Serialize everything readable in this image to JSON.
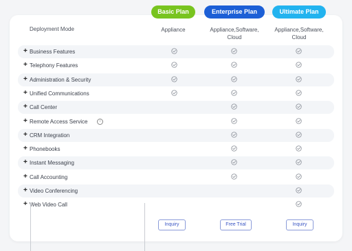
{
  "plans": [
    {
      "name": "Basic Plan",
      "color": "#78c41f"
    },
    {
      "name": "Enterprise Plan",
      "color": "#1c5fd6"
    },
    {
      "name": "Ultimate Plan",
      "color": "#22b3ef"
    }
  ],
  "deployment": {
    "label": "Deployment Mode",
    "values": [
      "Appliance",
      "Appliance,Software,\nCloud",
      "Appliance,Software,\nCloud"
    ]
  },
  "features": [
    {
      "label": "Business Features",
      "checks": [
        true,
        true,
        true
      ]
    },
    {
      "label": "Telephony Features",
      "checks": [
        true,
        true,
        true
      ]
    },
    {
      "label": "Administration & Security",
      "checks": [
        true,
        true,
        true
      ]
    },
    {
      "label": "Unified Communications",
      "checks": [
        true,
        true,
        true
      ]
    },
    {
      "label": "Call Center",
      "checks": [
        false,
        true,
        true
      ]
    },
    {
      "label": "Remote Access Service",
      "checks": [
        false,
        true,
        true
      ],
      "info": true
    },
    {
      "label": "CRM Integration",
      "checks": [
        false,
        true,
        true
      ]
    },
    {
      "label": "Phonebooks",
      "checks": [
        false,
        true,
        true
      ]
    },
    {
      "label": "Instant Messaging",
      "checks": [
        false,
        true,
        true
      ]
    },
    {
      "label": "Call Accounting",
      "checks": [
        false,
        true,
        true
      ]
    },
    {
      "label": "Video Conferencing",
      "checks": [
        false,
        false,
        true
      ]
    },
    {
      "label": "Web Video Call",
      "checks": [
        false,
        false,
        true
      ]
    }
  ],
  "buttons": [
    "Inquiry",
    "Free Trial",
    "Inquiry"
  ],
  "colors": {
    "check": "#8a8f98",
    "row_shade": "#f3f5f8",
    "button_border": "#8a9bd9"
  }
}
